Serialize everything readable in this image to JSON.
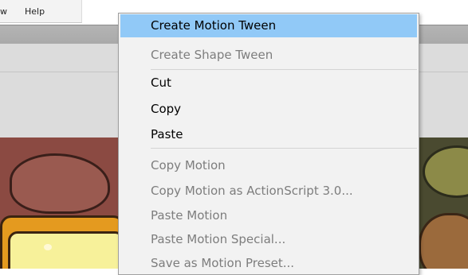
{
  "menubar": {
    "items": [
      "w",
      "Help"
    ]
  },
  "context_menu": {
    "highlight_color": "#91c9f7",
    "items": [
      {
        "label": "Create Motion Tween",
        "state": "highlighted"
      },
      {
        "label": "Create Shape Tween",
        "state": "disabled"
      },
      {
        "label": "Cut",
        "state": "enabled"
      },
      {
        "label": "Copy",
        "state": "enabled"
      },
      {
        "label": "Paste",
        "state": "enabled"
      },
      {
        "label": "Copy Motion",
        "state": "disabled"
      },
      {
        "label": "Copy Motion as ActionScript 3.0...",
        "state": "disabled"
      },
      {
        "label": "Paste Motion",
        "state": "disabled"
      },
      {
        "label": "Paste Motion Special...",
        "state": "disabled"
      },
      {
        "label": "Save as Motion Preset...",
        "state": "disabled"
      }
    ]
  }
}
